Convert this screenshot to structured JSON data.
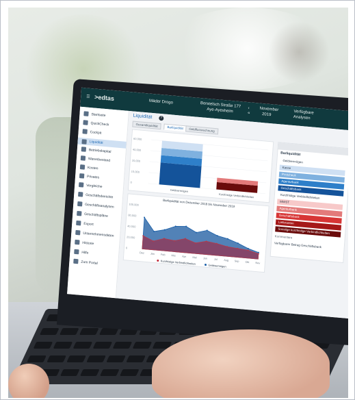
{
  "app": {
    "logo": ">edtas",
    "user": "Mäder Drogo",
    "address_line1": "Borstelsch Straße 177",
    "address_line2": "Aye-Ayesheim",
    "period_month": "November",
    "period_year": "2019",
    "available_label": "Verfügbare",
    "analyses_label": "Analysen"
  },
  "sidebar": {
    "items": [
      {
        "label": "Startseite",
        "icon": "grid-icon"
      },
      {
        "label": "QuickCheck",
        "icon": "check-icon"
      },
      {
        "label": "Cockpit",
        "icon": "gauge-icon"
      },
      {
        "label": "Liquidität",
        "icon": "coins-icon"
      },
      {
        "label": "Betriebskapital",
        "icon": "cube-icon"
      },
      {
        "label": "Warenbestand",
        "icon": "box-icon"
      },
      {
        "label": "Kosten",
        "icon": "tag-icon"
      },
      {
        "label": "Privates",
        "icon": "person-icon"
      },
      {
        "label": "Vergleiche",
        "icon": "compare-icon"
      },
      {
        "label": "Geschäftsberichte",
        "icon": "report-icon"
      },
      {
        "label": "Geschäftsanalysen",
        "icon": "analysis-icon"
      },
      {
        "label": "Geschäftspläne",
        "icon": "plan-icon"
      },
      {
        "label": "Export",
        "icon": "export-icon"
      },
      {
        "label": "Unternehmensdaten",
        "icon": "building-icon"
      },
      {
        "label": "Historie",
        "icon": "clock-icon"
      },
      {
        "label": "Hilfe",
        "icon": "help-icon"
      },
      {
        "label": "Zum Portal",
        "icon": "portal-icon"
      }
    ]
  },
  "main": {
    "title": "Liquidität",
    "tabs": [
      "Gesamtliquidität",
      "Barliquidität",
      "Geldflussrechnung"
    ],
    "bar_labels": [
      "Geldvermögen",
      "Kurzfristige Verbindlichkeiten"
    ],
    "side_title": "Barliquidität",
    "side_items": [
      {
        "label": "Geldvermögen",
        "color": "#ffffff"
      },
      {
        "label": "Kasse",
        "color": "#cfe0f3"
      },
      {
        "label": "Postcheck",
        "color": "#7fb1df"
      },
      {
        "label": "Agenturbank",
        "color": "#2e7fc9"
      },
      {
        "label": "Geschäftsbank",
        "color": "#14539a"
      },
      {
        "label": "Kurzfristige Verbindlichkeiten",
        "color": "#ffffff"
      },
      {
        "label": "MWST",
        "color": "#f7c9c9"
      },
      {
        "label": "Agenturbank",
        "color": "#e37a7a"
      },
      {
        "label": "Geschäftsbank",
        "color": "#d73535"
      },
      {
        "label": "Lieferanten",
        "color": "#a51818"
      },
      {
        "label": "Sonstige kurzfristige Verbindlichkeiten",
        "color": "#6a0b0b"
      }
    ],
    "comments_label": "Kommentare",
    "comment_text": "Verfügbarer Betrag Geschäftsbank",
    "chart_title": "Barliquidität von Dezember 2018 bis November 2019",
    "legend": [
      "Kurzfristige Verbindlichkeiten",
      "Geldvermögen"
    ]
  },
  "chart_data": [
    {
      "type": "bar",
      "categories": [
        "Geldvermögen",
        "Kurzfristige Verbindlichkeiten"
      ],
      "series": [
        {
          "values": [
            30000,
            10000
          ]
        },
        {
          "values": [
            10000,
            0
          ]
        },
        {
          "values": [
            10000,
            6000
          ]
        },
        {
          "values": [
            10000,
            0
          ]
        }
      ],
      "ylim": [
        0,
        60000
      ],
      "yticks": [
        "60,000",
        "40,000",
        "20,000",
        "10,000",
        "0"
      ]
    },
    {
      "type": "area",
      "title": "Barliquidität von Dezember 2018 bis November 2019",
      "categories": [
        "Dez",
        "Jan",
        "Feb",
        "Mrz",
        "Apr",
        "Mai",
        "Jun",
        "Jul",
        "Aug",
        "Sep",
        "Okt",
        "Nov"
      ],
      "series": [
        {
          "name": "Geldvermögen",
          "values": [
            72000,
            42000,
            48000,
            58000,
            60000,
            48000,
            55000,
            45000,
            40000,
            32000,
            22000,
            15000
          ],
          "color": "#1a5fa8"
        },
        {
          "name": "Kurzfristige Verbindlichkeiten",
          "values": [
            30000,
            20000,
            28000,
            25000,
            32000,
            24000,
            30000,
            27000,
            22000,
            20000,
            18000,
            12000
          ],
          "color": "#b53a4a"
        }
      ],
      "ylim": [
        0,
        100000
      ],
      "yticks": [
        "100,000",
        "80,000",
        "40,000",
        "20,000",
        "0"
      ]
    }
  ]
}
